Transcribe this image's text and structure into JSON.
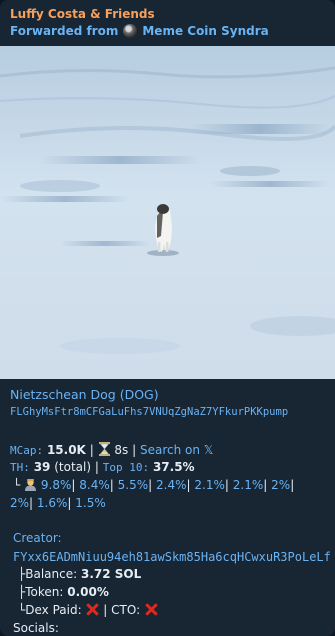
{
  "message": {
    "sender": "Luffy Costa & Friends",
    "forwarded_prefix": "Forwarded from",
    "forwarded_channel": "Meme Coin Syndra"
  },
  "token": {
    "name": "Nietzschean Dog (DOG)",
    "contract": "FLGhyMsFtr8mCFGaLuFhs7VNUqZgNaZ7YFkurPKKpump"
  },
  "stats": {
    "mcap_label": "MCap:",
    "mcap_value": "15.0K",
    "age_value": "8s",
    "search_link": "Search on 𝕏",
    "th_label": "TH:",
    "th_total": "39",
    "th_total_suffix": "(total)",
    "top10_label": "Top 10:",
    "top10_value": "37.5%",
    "holders_line1": [
      "9.8%",
      "8.4%",
      "5.5%",
      "2.4%",
      "2.1%",
      "2.1%",
      "2%"
    ],
    "holders_line2": [
      "2%",
      "1.6%",
      "1.5%"
    ]
  },
  "creator": {
    "label": "Creator:",
    "address": "FYxx6EADmNiuu94eh81awSkm85Ha6cqHCwxuR3PoLeLf",
    "balance_label": "Balance:",
    "balance_value": "3.72 SOL",
    "token_label": "Token:",
    "token_value": "0.00%",
    "dex_label": "Dex Paid:",
    "cto_label": "CTO:"
  },
  "socials_label": "Socials:",
  "icons": {
    "hourglass": "hourglass-icon",
    "holder": "person-icon",
    "cross": "red-cross-icon",
    "channel": "channel-avatar"
  },
  "colors": {
    "bg": "#182533",
    "link": "#6ab3f3",
    "sender": "#f5a15c",
    "text": "#e6edf3",
    "cross": "#e0281f"
  }
}
